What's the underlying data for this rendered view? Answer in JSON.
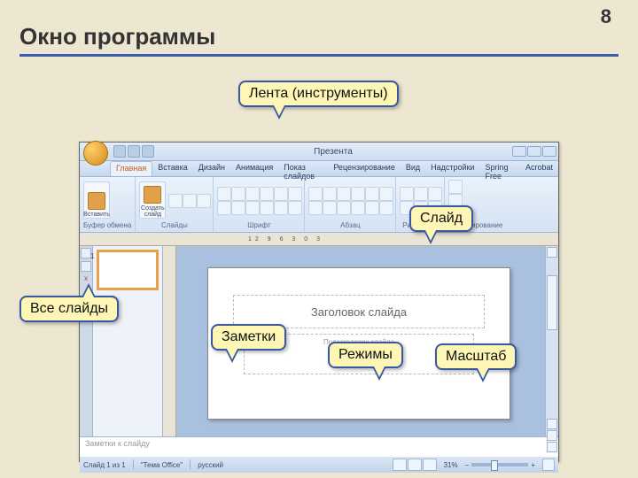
{
  "page": {
    "number": "8",
    "title": "Окно программы"
  },
  "app": {
    "title": "Презента",
    "tabs": [
      "Главная",
      "Вставка",
      "Дизайн",
      "Анимация",
      "Показ слайдов",
      "Рецензирование",
      "Вид",
      "Надстройки",
      "Spring Free",
      "Acrobat"
    ],
    "active_tab": 0,
    "groups": {
      "clipboard": "Буфер обмена",
      "slides": "Слайды",
      "font": "Шрифт",
      "paragraph": "Абзац",
      "drawing": "Рисование",
      "editing": "Редактирование"
    },
    "paste": "Вставить",
    "newslide": "Создать\nслайд",
    "ruler": "12    9    6    3    0    3",
    "slide_title": "Заголовок слайда",
    "slide_sub": "Подзаголовок слайда",
    "notes_placeholder": "Заметки к слайду",
    "status": {
      "slide": "Слайд 1 из 1",
      "theme": "\"Тема Office\"",
      "lang": "русский",
      "zoom": "31%"
    }
  },
  "callouts": {
    "ribbon": "Лента (инструменты)",
    "slide": "Слайд",
    "all_slides": "Все слайды",
    "notes": "Заметки",
    "modes": "Режимы",
    "zoom": "Масштаб"
  }
}
